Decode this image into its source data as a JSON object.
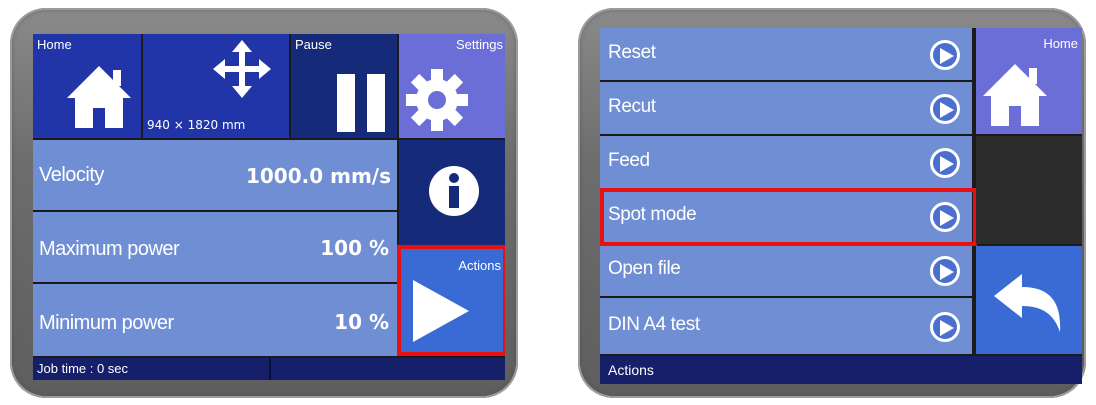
{
  "left_panel": {
    "home_tile": {
      "label": "Home",
      "icon": "home-icon"
    },
    "move_tile": {
      "size_text": "940 × 1820 mm",
      "icon": "move-arrows-icon"
    },
    "pause_tile": {
      "label": "Pause",
      "icon": "pause-icon"
    },
    "settings_tile": {
      "label": "Settings",
      "icon": "gear-icon"
    },
    "params": [
      {
        "label": "Velocity",
        "value": "1000.0 mm/s"
      },
      {
        "label": "Maximum power",
        "value": "100 %"
      },
      {
        "label": "Minimum power",
        "value": "10 %"
      }
    ],
    "info_tile": {
      "icon": "info-icon"
    },
    "actions_tile": {
      "label": "Actions",
      "icon": "play-icon"
    },
    "status_bar": {
      "job_time": "Job time : 0 sec"
    }
  },
  "right_panel": {
    "menu_items": [
      {
        "label": "Reset"
      },
      {
        "label": "Recut"
      },
      {
        "label": "Feed"
      },
      {
        "label": "Spot mode"
      },
      {
        "label": "Open file"
      },
      {
        "label": "DIN A4 test"
      }
    ],
    "home_tile": {
      "label": "Home",
      "icon": "home-icon"
    },
    "back_tile": {
      "icon": "back-arrow-icon"
    },
    "status_bar": {
      "title": "Actions"
    }
  },
  "colors": {
    "tile_dark_blue": "#2235a8",
    "tile_navy": "#162a7a",
    "tile_lavender": "#6a6ed6",
    "row_blue": "#6f8ed4",
    "action_blue": "#3a6ad4",
    "highlight_red": "#e81010",
    "status_navy": "#16206a"
  }
}
